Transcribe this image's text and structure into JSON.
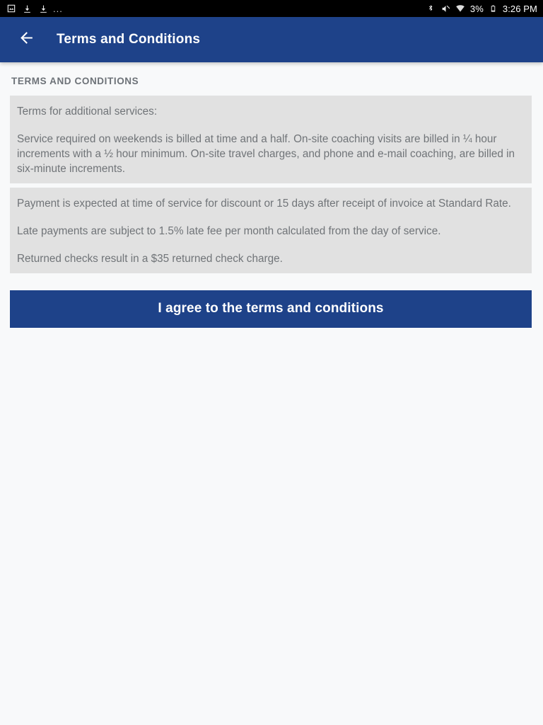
{
  "status_bar": {
    "left_icons": [
      "image-icon",
      "download-icon",
      "download-icon",
      "more-dots-icon"
    ],
    "dots": "...",
    "right_icons": [
      "bluetooth-icon",
      "volume-mute-icon",
      "wifi-icon"
    ],
    "battery_percent": "3%",
    "battery_icon": "battery-icon",
    "time": "3:26 PM",
    "background_color": "#000000"
  },
  "app_bar": {
    "back_icon": "arrow-back-icon",
    "title": "Terms and Conditions",
    "background_color": "#1e4289",
    "text_color": "#ffffff"
  },
  "content": {
    "section_header": "TERMS AND CONDITIONS",
    "card_background_color": "#e1e1e1",
    "body_text_color": "#707478",
    "cards": [
      {
        "paragraphs": [
          "Terms for additional services:",
          "Service required on weekends is billed at time and a half. On-site coaching visits are billed in ¼ hour increments with a ½ hour minimum. On-site travel charges, and phone and e-mail coaching, are billed in six-minute increments."
        ]
      },
      {
        "paragraphs": [
          "Payment is expected at time of service for discount or 15 days after receipt of invoice at Standard Rate.",
          "Late payments are subject to 1.5% late fee per month calculated from the day of service.",
          "Returned checks result in a $35 returned check charge."
        ]
      }
    ],
    "agree_button": {
      "label": "I agree to the terms and conditions",
      "background_color": "#1e4289",
      "text_color": "#ffffff"
    }
  }
}
